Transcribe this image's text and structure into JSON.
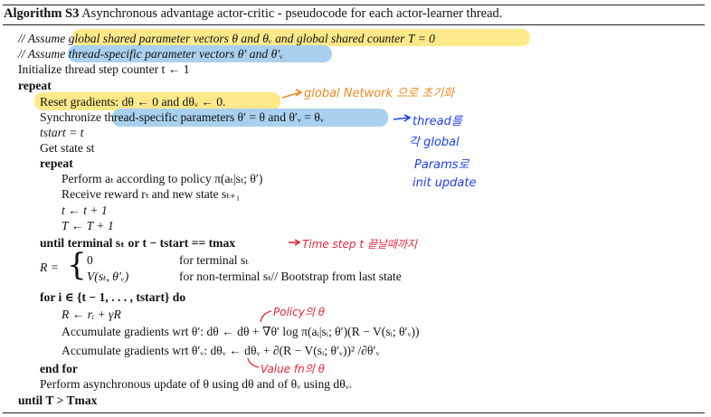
{
  "title": {
    "label": "Algorithm S3",
    "text": "Asynchronous advantage actor-critic - pseudocode for each actor-learner thread."
  },
  "lines": {
    "l1": "// Assume global shared parameter vectors θ and θᵥ and global shared counter T = 0",
    "l2": "// Assume thread-specific parameter vectors θ′ and θ′ᵥ",
    "l3": "Initialize thread step counter t ← 1",
    "l4": "repeat",
    "l5": "Reset gradients: dθ ← 0 and dθᵥ ← 0.",
    "l6": "Synchronize thread-specific parameters θ′ = θ and θ′ᵥ = θᵥ",
    "l7": "tstart = t",
    "l8": "Get state st",
    "l9": "repeat",
    "l10": "Perform aₜ according to policy π(aₜ|sₜ; θ′)",
    "l11": "Receive reward rₜ and new state sₜ₊₁",
    "l12": "t ← t + 1",
    "l13": "T ← T + 1",
    "l14": "until terminal sₜ or t − tstart == tmax",
    "l15a": "R =",
    "l15b": "0",
    "l15c": "for terminal sₜ",
    "l16b": "V(sₜ, θ′ᵥ)",
    "l16c": "for non-terminal sₜ// Bootstrap from last state",
    "l17": "for i ∈ {t − 1, . . . , tstart} do",
    "l18": "R ← rᵢ + γR",
    "l19": "Accumulate gradients wrt θ′: dθ ← dθ + ∇θ′ log π(aᵢ|sᵢ; θ′)(R − V(sᵢ; θ′ᵥ))",
    "l20": "Accumulate gradients wrt θ′ᵥ: dθᵥ ← dθᵥ + ∂(R − V(sᵢ; θ′ᵥ))² /∂θ′ᵥ",
    "l21": "end for",
    "l22": "Perform asynchronous update of θ using dθ and of θᵥ using dθᵥ.",
    "l23": "until T > Tmax"
  },
  "annotations": {
    "global_net": "global Network 으로 초기화",
    "thread_1": "thread를",
    "thread_2": "각 global",
    "thread_3": "Params로",
    "thread_4": "init update",
    "timestep": "Time step t 끝날때까지",
    "policy": "Policy의 θ",
    "value": "Value fn의 θ"
  },
  "colors": {
    "highlight_yellow": "#fde98a",
    "highlight_blue": "#a9d1ef",
    "ink_red": "#e8263a",
    "ink_orange": "#f08a1f",
    "ink_blue": "#1f3df0"
  }
}
